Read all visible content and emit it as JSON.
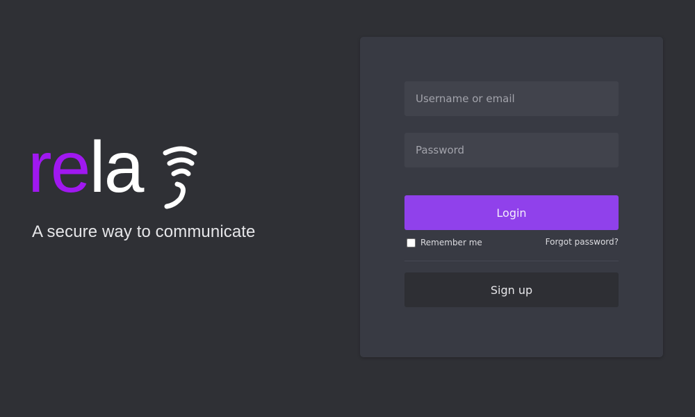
{
  "brand": {
    "logo_text_accent": "re",
    "logo_text_plain": "la",
    "logo_icon": "signal-wave-icon",
    "tagline": "A secure way to communicate",
    "colors": {
      "accent": "#a018f0",
      "plain": "#ffffff"
    }
  },
  "login_form": {
    "username_placeholder": "Username or email",
    "username_value": "",
    "password_placeholder": "Password",
    "password_value": "",
    "login_label": "Login",
    "remember_label": "Remember me",
    "remember_checked": false,
    "forgot_label": "Forgot password?",
    "signup_label": "Sign up",
    "colors": {
      "background": "#2f3035",
      "card": "#383a43",
      "input": "#41434c",
      "primary_button": "#9041eb",
      "secondary_button": "#2e2f34"
    }
  }
}
